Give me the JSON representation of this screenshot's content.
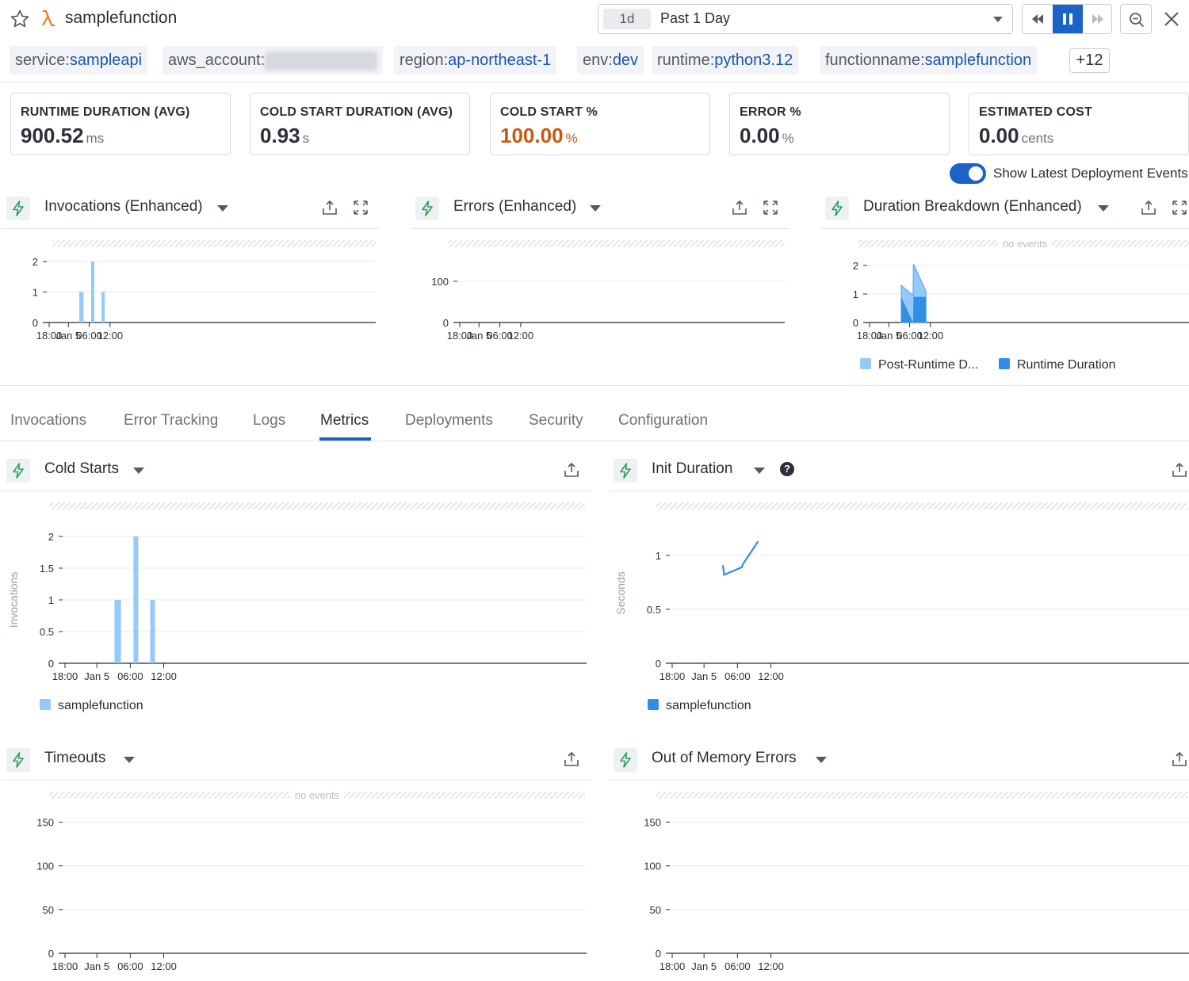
{
  "header": {
    "function_name": "samplefunction",
    "time_picker": {
      "badge": "1d",
      "label": "Past 1 Day"
    },
    "tags": [
      {
        "key": "service:",
        "value": "sampleapi"
      },
      {
        "key": "aws_account:",
        "value": ""
      },
      {
        "key": "region:",
        "value": "ap-northeast-1"
      },
      {
        "key": "env:",
        "value": "dev"
      },
      {
        "key": "runtime:",
        "value": "python3.12"
      },
      {
        "key": "functionname:",
        "value": "samplefunction"
      }
    ],
    "more_tags": "+12"
  },
  "kpis": [
    {
      "label": "RUNTIME DURATION (AVG)",
      "value": "900.52",
      "unit": "ms"
    },
    {
      "label": "COLD START DURATION (AVG)",
      "value": "0.93",
      "unit": "s"
    },
    {
      "label": "COLD START %",
      "value": "100.00",
      "unit": "%",
      "status": "warning"
    },
    {
      "label": "ERROR %",
      "value": "0.00",
      "unit": "%"
    },
    {
      "label": "ESTIMATED COST",
      "value": "0.00",
      "unit": "cents"
    }
  ],
  "deployment_toggle": {
    "label": "Show Latest Deployment Events",
    "on": true
  },
  "no_events_text": "no events",
  "colors": {
    "accent": "#1b63c6",
    "bar_light": "#94c9fb",
    "series_dark": "#2f8ee8",
    "warning": "#c55b0f"
  },
  "widgets": {
    "invocations": {
      "title": "Invocations (Enhanced)"
    },
    "errors": {
      "title": "Errors (Enhanced)"
    },
    "duration_breakdown": {
      "title": "Duration Breakdown (Enhanced)",
      "legend": [
        "Post-Runtime D...",
        "Runtime Duration"
      ]
    },
    "cold_starts": {
      "title": "Cold Starts",
      "ylabel": "Invocations",
      "legend": "samplefunction"
    },
    "init_duration": {
      "title": "Init Duration",
      "ylabel": "Seconds",
      "legend": "samplefunction"
    },
    "timeouts": {
      "title": "Timeouts"
    },
    "oom": {
      "title": "Out of Memory Errors"
    }
  },
  "tabs": [
    "Invocations",
    "Error Tracking",
    "Logs",
    "Metrics",
    "Deployments",
    "Security",
    "Configuration"
  ],
  "active_tab": "Metrics",
  "chart_data": [
    {
      "id": "invocations",
      "type": "bar",
      "title": "Invocations (Enhanced)",
      "x_ticks": [
        "18:00",
        "Jan 5",
        "06:00",
        "12:00"
      ],
      "y_ticks": [
        0,
        1,
        2
      ],
      "ylim": [
        0,
        2
      ],
      "series": [
        {
          "values": [
            {
              "x": 9.6,
              "y": 1
            },
            {
              "x": 9.9,
              "y": 1
            },
            {
              "x": 13.0,
              "y": 2
            },
            {
              "x": 16.0,
              "y": 1
            }
          ]
        }
      ]
    },
    {
      "id": "errors",
      "type": "bar",
      "title": "Errors (Enhanced)",
      "x_ticks": [
        "18:00",
        "Jan 5",
        "06:00",
        "12:00"
      ],
      "y_ticks": [
        0,
        100
      ],
      "ylim": [
        0,
        100
      ],
      "series": []
    },
    {
      "id": "duration_breakdown",
      "type": "area",
      "title": "Duration Breakdown (Enhanced)",
      "x_ticks": [
        "18:00",
        "Jan 5",
        "06:00",
        "12:00"
      ],
      "y_ticks": [
        0,
        1,
        2
      ],
      "ylim": [
        0,
        2
      ],
      "series": [
        {
          "name": "Post-Runtime D...",
          "values": [
            {
              "x": 9.6,
              "y": 1.3
            },
            {
              "x": 13.0,
              "y": 0.95
            },
            {
              "x": 13.1,
              "y": 2.05
            },
            {
              "x": 16.7,
              "y": 1.1
            }
          ]
        },
        {
          "name": "Runtime Duration",
          "values": [
            {
              "x": 9.6,
              "y": 0.9
            },
            {
              "x": 13.0,
              "y": 0
            },
            {
              "x": 13.1,
              "y": 0.9
            },
            {
              "x": 16.7,
              "y": 0.9
            }
          ]
        }
      ]
    },
    {
      "id": "cold_starts",
      "type": "bar",
      "title": "Cold Starts",
      "ylabel": "Invocations",
      "x_ticks": [
        "18:00",
        "Jan 5",
        "06:00",
        "12:00"
      ],
      "y_ticks": [
        "0",
        "0.5",
        "1",
        "1.5",
        "2"
      ],
      "ylim": [
        0,
        2
      ],
      "series": [
        {
          "name": "samplefunction",
          "values": [
            {
              "x": 9.6,
              "y": 1
            },
            {
              "x": 9.9,
              "y": 1
            },
            {
              "x": 13.0,
              "y": 2
            },
            {
              "x": 16.0,
              "y": 1
            }
          ]
        }
      ]
    },
    {
      "id": "init_duration",
      "type": "line",
      "title": "Init Duration",
      "ylabel": "Seconds",
      "x_ticks": [
        "18:00",
        "Jan 5",
        "06:00",
        "12:00"
      ],
      "y_ticks": [
        "0",
        "0.5",
        "1"
      ],
      "ylim": [
        0,
        1.3
      ],
      "series": [
        {
          "name": "samplefunction",
          "values": [
            {
              "x": 9.4,
              "y": 0.91
            },
            {
              "x": 9.6,
              "y": 0.82
            },
            {
              "x": 12.8,
              "y": 0.89
            },
            {
              "x": 13.0,
              "y": 0.92
            },
            {
              "x": 15.7,
              "y": 1.13
            }
          ]
        }
      ]
    },
    {
      "id": "timeouts",
      "type": "bar",
      "title": "Timeouts",
      "x_ticks": [
        "18:00",
        "Jan 5",
        "06:00",
        "12:00"
      ],
      "y_ticks": [
        0,
        50,
        100,
        150
      ],
      "ylim": [
        0,
        175
      ],
      "series": []
    },
    {
      "id": "oom",
      "type": "bar",
      "title": "Out of Memory Errors",
      "x_ticks": [
        "18:00",
        "Jan 5",
        "06:00",
        "12:00"
      ],
      "y_ticks": [
        0,
        50,
        100,
        150
      ],
      "ylim": [
        0,
        175
      ],
      "series": []
    }
  ]
}
